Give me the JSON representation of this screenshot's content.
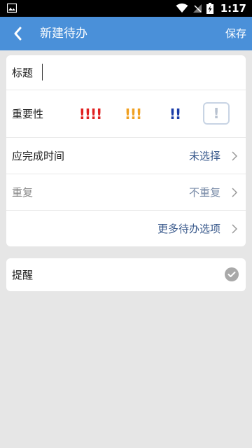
{
  "status": {
    "time": "1:17"
  },
  "appbar": {
    "title": "新建待办",
    "save_label": "保存"
  },
  "form": {
    "title_label": "标题",
    "importance_label": "重要性",
    "priorities": [
      {
        "text": "!!!!",
        "color": "#e02020"
      },
      {
        "text": "!!!",
        "color": "#f0a020"
      },
      {
        "text": "!!",
        "color": "#1a3ca8"
      },
      {
        "text": "!",
        "color": "#b8c2d0"
      }
    ],
    "due_label": "应完成时间",
    "due_value": "未选择",
    "repeat_label": "重复",
    "repeat_value": "不重复",
    "more_options": "更多待办选项"
  },
  "reminder": {
    "label": "提醒"
  }
}
